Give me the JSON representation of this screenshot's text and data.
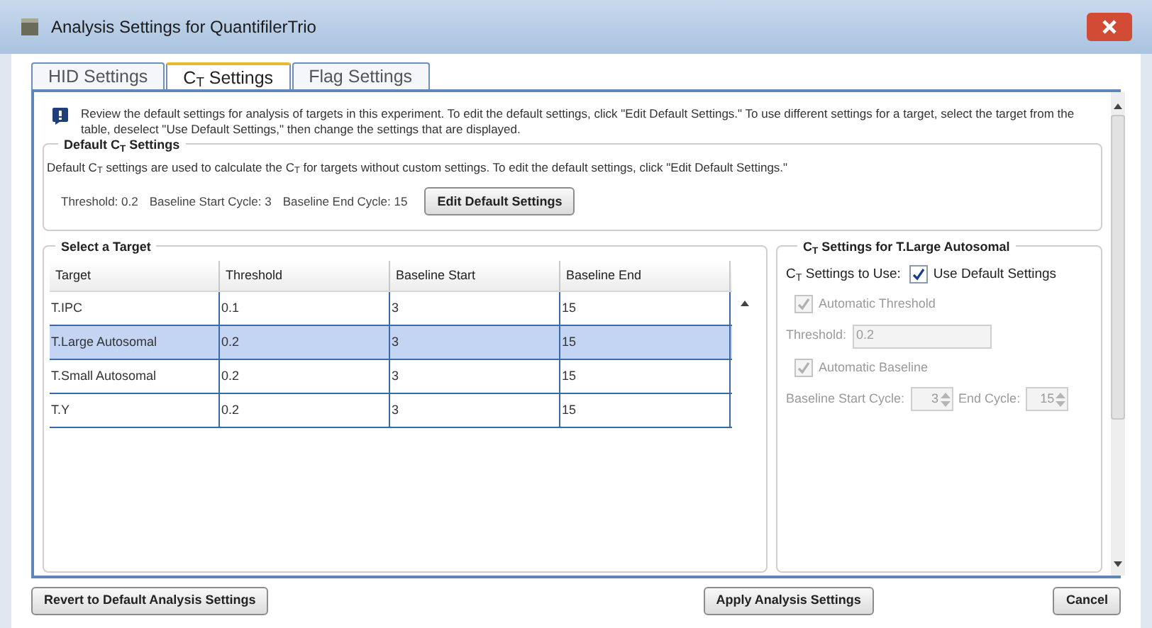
{
  "window": {
    "title": "Analysis Settings for QuantifilerTrio"
  },
  "tabs": [
    {
      "label": "HID Settings",
      "selected": false
    },
    {
      "label": "C$_{T}$ Settings",
      "selected": true
    },
    {
      "label": "Flag Settings",
      "selected": false
    }
  ],
  "info": "Review the default settings for analysis of targets in this experiment. To edit the default settings, click \"Edit Default Settings.\" To use different settings for a target, select the target from the table, deselect \"Use Default Settings,\" then change the settings that are displayed.",
  "default_settings": {
    "title": "Default C$_{T}$ Settings",
    "description": "Default C$_{T}$ settings are used to calculate the C$_{T}$ for targets without custom settings. To edit the default settings, click \"Edit Default Settings.\"",
    "values": [
      "Threshold: 0.2",
      "Baseline Start Cycle: 3",
      "Baseline End Cycle: 15"
    ],
    "button": "Edit Default Settings"
  },
  "target_table": {
    "title": "Select a Target",
    "columns": [
      "Target",
      "Threshold",
      "Baseline Start",
      "Baseline End"
    ],
    "rows": [
      {
        "cells": [
          "T.IPC",
          "0.1",
          "3",
          "15"
        ],
        "selected": false
      },
      {
        "cells": [
          "T.Large Autosomal",
          "0.2",
          "3",
          "15"
        ],
        "selected": true
      },
      {
        "cells": [
          "T.Small Autosomal",
          "0.2",
          "3",
          "15"
        ],
        "selected": false
      },
      {
        "cells": [
          "T.Y",
          "0.2",
          "3",
          "15"
        ],
        "selected": false
      }
    ]
  },
  "target_settings": {
    "title": "C$_{T}$ Settings for T.Large Autosomal",
    "use_label": "C$_{T}$ Settings to Use:",
    "use_default": {
      "label": "Use Default Settings",
      "checked": true
    },
    "auto_threshold": {
      "label": "Automatic Threshold",
      "checked": true,
      "disabled": true
    },
    "threshold": {
      "label": "Threshold:",
      "value": "0.2",
      "disabled": true
    },
    "auto_baseline": {
      "label": "Automatic Baseline",
      "checked": true,
      "disabled": true
    },
    "start_cycle": {
      "label": "Baseline Start Cycle:",
      "value": "3",
      "disabled": true
    },
    "end_cycle": {
      "label": "End Cycle:",
      "value": "15",
      "disabled": true
    }
  },
  "buttons": [
    "Revert to Default Analysis Settings",
    "Apply Analysis Settings",
    "Cancel"
  ]
}
